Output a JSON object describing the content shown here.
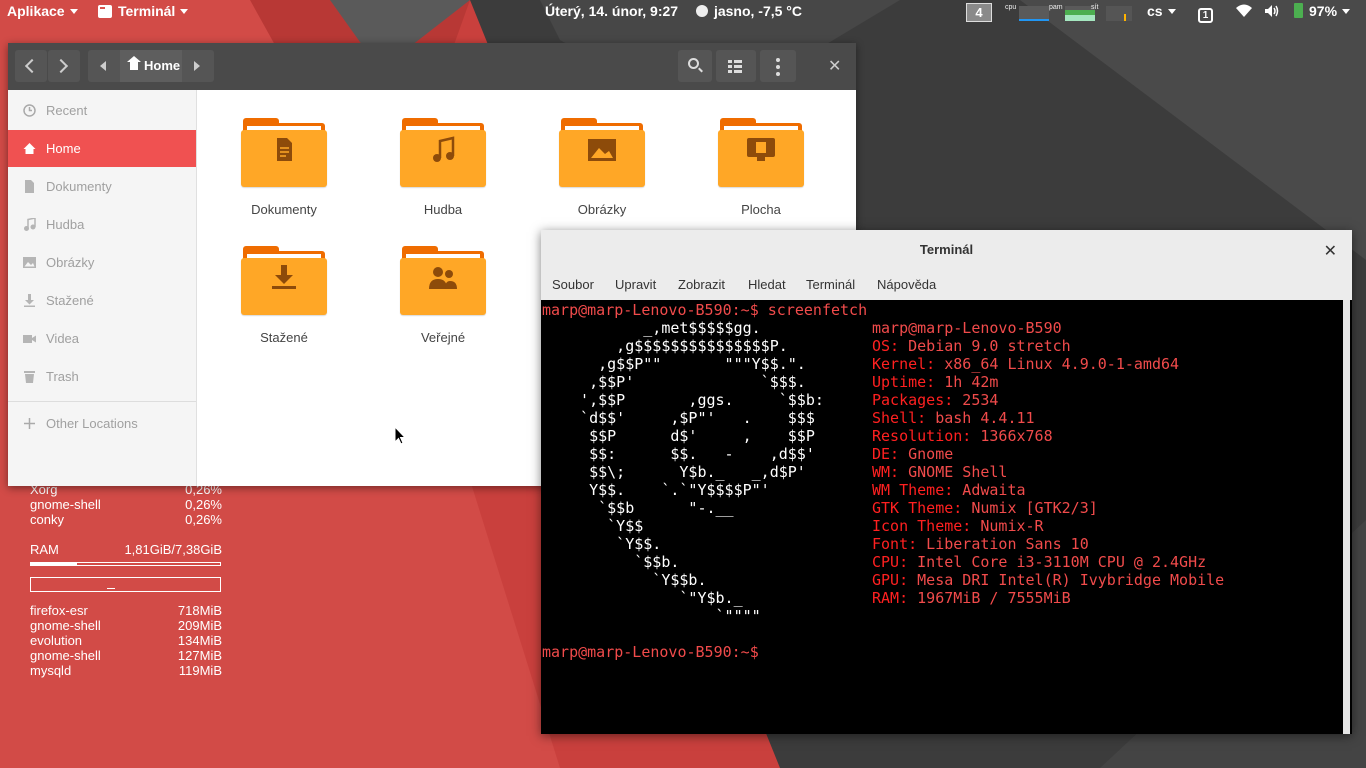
{
  "topbar": {
    "apps_label": "Aplikace",
    "active_app": "Terminál",
    "datetime": "Úterý, 14. únor,  9:27",
    "weather": "jasno, -7,5 °C",
    "workspace": "4",
    "indicator_cpu": "cpu",
    "indicator_mem": "pam",
    "indicator_net": "sít",
    "keyboard_layout": "cs",
    "notifications": "1",
    "battery": "97%"
  },
  "conky": {
    "processes_cpu": [
      {
        "name": "Xorg",
        "value": "0,26%"
      },
      {
        "name": "gnome-shell",
        "value": "0,26%"
      },
      {
        "name": "conky",
        "value": "0,26%"
      }
    ],
    "ram_label": "RAM",
    "ram_value": "1,81GiB/7,38GiB",
    "ram_fraction": 0.245,
    "processes_mem": [
      {
        "name": "firefox-esr",
        "value": "718MiB"
      },
      {
        "name": "gnome-shell",
        "value": "209MiB"
      },
      {
        "name": "evolution",
        "value": "134MiB"
      },
      {
        "name": "gnome-shell",
        "value": "127MiB"
      },
      {
        "name": "mysqld",
        "value": "119MiB"
      }
    ]
  },
  "files": {
    "path_label": "Home",
    "sidebar": [
      {
        "label": "Recent",
        "icon": "clock-icon"
      },
      {
        "label": "Home",
        "icon": "home-icon",
        "active": true
      },
      {
        "label": "Dokumenty",
        "icon": "document-icon"
      },
      {
        "label": "Hudba",
        "icon": "music-icon"
      },
      {
        "label": "Obrázky",
        "icon": "picture-icon"
      },
      {
        "label": "Stažené",
        "icon": "download-icon"
      },
      {
        "label": "Videa",
        "icon": "video-icon"
      },
      {
        "label": "Trash",
        "icon": "trash-icon"
      },
      {
        "label": "Other Locations",
        "icon": "plus-icon"
      }
    ],
    "folders": [
      {
        "label": "Dokumenty",
        "icon": "document-icon"
      },
      {
        "label": "Hudba",
        "icon": "music-icon"
      },
      {
        "label": "Obrázky",
        "icon": "picture-icon"
      },
      {
        "label": "Plocha",
        "icon": "desktop-icon"
      },
      {
        "label": "Stažené",
        "icon": "download-icon"
      },
      {
        "label": "Veřejné",
        "icon": "people-icon"
      }
    ]
  },
  "terminal": {
    "title": "Terminál",
    "menu": [
      "Soubor",
      "Upravit",
      "Zobrazit",
      "Hledat",
      "Terminál",
      "Nápověda"
    ],
    "prompt1": "marp@marp-Lenovo-B590:~$ screenfetch",
    "prompt2": "marp@marp-Lenovo-B590:~$",
    "logo": [
      "         _,met$$$$$gg.",
      "      ,g$$$$$$$$$$$$$$$P.",
      "    ,g$$P\"\"       \"\"\"Y$$.\".",
      "   ,$$P'              `$$$.",
      "  ',$$P       ,ggs.     `$$b:",
      "  `d$$'     ,$P\"'   .    $$$",
      "   $$P      d$'     ,    $$P",
      "   $$:      $$.   -    ,d$$'",
      "   $$\\;      Y$b._   _,d$P'",
      "   Y$$.    `.`\"Y$$$$P\"'",
      "    `$$b      \"-.__",
      "     `Y$$",
      "      `Y$$.",
      "        `$$b.",
      "          `Y$$b.",
      "             `\"Y$b._",
      "                 `\"\"\"\""
    ],
    "info": [
      {
        "key": "",
        "value": "marp@marp-Lenovo-B590"
      },
      {
        "key": "OS:",
        "value": " Debian 9.0 stretch"
      },
      {
        "key": "Kernel:",
        "value": " x86_64 Linux 4.9.0-1-amd64"
      },
      {
        "key": "Uptime:",
        "value": " 1h 42m"
      },
      {
        "key": "Packages:",
        "value": " 2534"
      },
      {
        "key": "Shell:",
        "value": " bash 4.4.11"
      },
      {
        "key": "Resolution:",
        "value": " 1366x768"
      },
      {
        "key": "DE:",
        "value": " Gnome"
      },
      {
        "key": "WM:",
        "value": " GNOME Shell"
      },
      {
        "key": "WM Theme:",
        "value": " Adwaita"
      },
      {
        "key": "GTK Theme:",
        "value": " Numix [GTK2/3]"
      },
      {
        "key": "Icon Theme:",
        "value": " Numix-R"
      },
      {
        "key": "Font:",
        "value": " Liberation Sans 10"
      },
      {
        "key": "CPU:",
        "value": " Intel Core i3-3110M CPU @ 2.4GHz"
      },
      {
        "key": "GPU:",
        "value": " Mesa DRI Intel(R) Ivybridge Mobile"
      },
      {
        "key": "RAM:",
        "value": " 1967MiB / 7555MiB"
      }
    ]
  },
  "colors": {
    "accent": "#f05151",
    "wallpaper_red": "#c9403d",
    "wallpaper_dark": "#3a3a3a",
    "folder_orange": "#ffa726",
    "terminal_red": "#f14b4b"
  }
}
